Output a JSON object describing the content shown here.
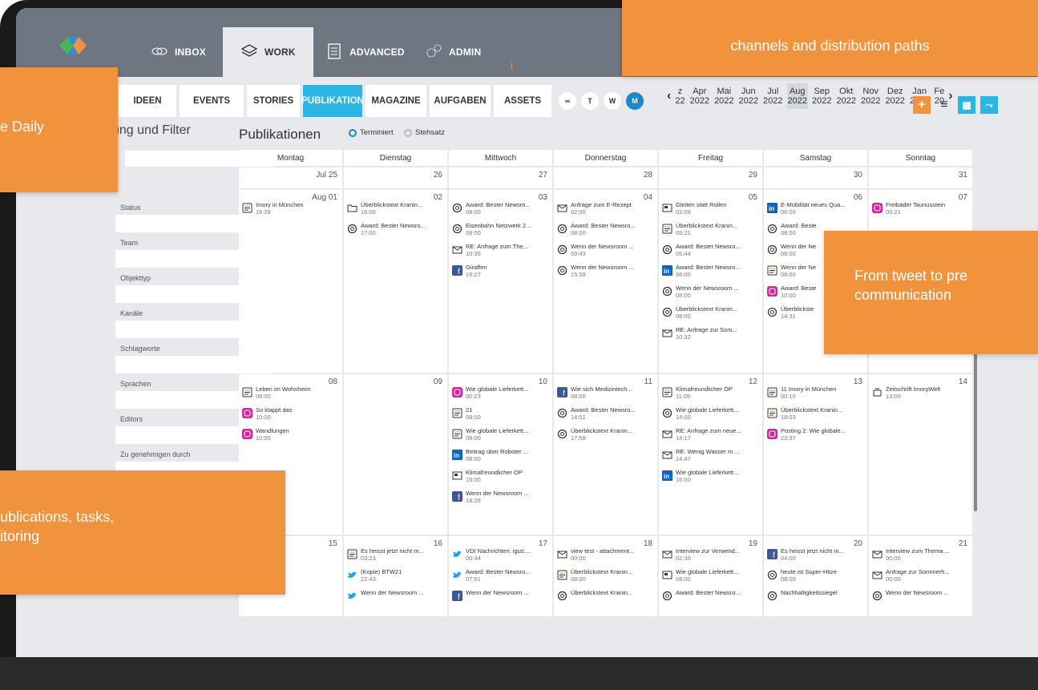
{
  "nav": {
    "tabs": [
      {
        "label": "INBOX",
        "icon": "inbox-icon"
      },
      {
        "label": "WORK",
        "icon": "layers-icon",
        "active": true
      },
      {
        "label": "ADVANCED",
        "icon": "document-icon"
      },
      {
        "label": "ADMIN",
        "icon": "gears-icon"
      }
    ],
    "marker": "i"
  },
  "subtabs": [
    "IDEEN",
    "EVENTS",
    "STORIES",
    "PUBLIKATION",
    "MAGAZINE",
    "AUFGABEN",
    "ASSETS"
  ],
  "view_buttons": [
    "∞",
    "T",
    "W",
    "M"
  ],
  "months": [
    {
      "m": "z",
      "y": "22"
    },
    {
      "m": "Apr",
      "y": "2022"
    },
    {
      "m": "Mai",
      "y": "2022"
    },
    {
      "m": "Jun",
      "y": "2022"
    },
    {
      "m": "Jul",
      "y": "2022"
    },
    {
      "m": "Aug",
      "y": "2022"
    },
    {
      "m": "Sep",
      "y": "2022"
    },
    {
      "m": "Okt",
      "y": "2022"
    },
    {
      "m": "Nov",
      "y": "2022"
    },
    {
      "m": "Dez",
      "y": "2022"
    },
    {
      "m": "Jan",
      "y": "2023"
    },
    {
      "m": "Fe",
      "y": "20"
    }
  ],
  "filter": {
    "title": "ung und Filter",
    "fields": [
      "Status",
      "Team",
      "Objekttyp",
      "Kanäle",
      "Schlagworte",
      "Sprachen",
      "Editors",
      "Zu genehmigen durch"
    ]
  },
  "calendar": {
    "title": "Publikationen",
    "radio_on": "Terminiert",
    "radio_off": "Stehsatz",
    "days": [
      "Montag",
      "Dienstag",
      "Mittwoch",
      "Donnerstag",
      "Freitag",
      "Samstag",
      "Sonntag"
    ],
    "week0": [
      "Jul 25",
      "26",
      "27",
      "28",
      "29",
      "30",
      "31"
    ],
    "week1": [
      {
        "n": "Aug 01",
        "ev": [
          [
            "doc",
            "Imory in München",
            "16:28"
          ]
        ]
      },
      {
        "n": "02",
        "ev": [
          [
            "folder",
            "Überblickstext Kranin...",
            "16:06"
          ],
          [
            "at",
            "Award: Bester Newsro...",
            "17:00"
          ]
        ]
      },
      {
        "n": "03",
        "ev": [
          [
            "at",
            "Award: Bester Newsro...",
            "08:00"
          ],
          [
            "at",
            "Eisenbahn Netzwerk 2...",
            "08:00"
          ],
          [
            "mail",
            "RE: Anfrage zum The...",
            "10:35"
          ],
          [
            "fb",
            "Giraffen",
            "19:27"
          ]
        ]
      },
      {
        "n": "04",
        "ev": [
          [
            "mail",
            "Anfrage zum E-Rezept",
            "02:00"
          ],
          [
            "at",
            "Award: Bester Newsro...",
            "08:00"
          ],
          [
            "at",
            "Wenn der Newsroom ...",
            "09:43"
          ],
          [
            "at",
            "Wenn der Newsroom ...",
            "15:58"
          ]
        ]
      },
      {
        "n": "05",
        "ev": [
          [
            "news",
            "Gleiten statt Rollen",
            "02:09"
          ],
          [
            "doc",
            "Überblickstext Kranin...",
            "05:21"
          ],
          [
            "at",
            "Award: Bester Newsro...",
            "05:44"
          ],
          [
            "in",
            "Award: Bester Newsro...",
            "08:00"
          ],
          [
            "at",
            "Wenn der Newsroom ...",
            "08:00"
          ],
          [
            "at",
            "Überblickstext Kranin...",
            "08:00"
          ],
          [
            "mail",
            "RE: Anfrage zur Som...",
            "10:32"
          ]
        ]
      },
      {
        "n": "06",
        "ev": [
          [
            "in",
            "E-Mobilität neues Qua...",
            "06:00"
          ],
          [
            "at",
            "Award: Beste",
            "08:00"
          ],
          [
            "at",
            "Wenn der Ne",
            "08:00"
          ],
          [
            "doc",
            "Wenn der Ne",
            "08:00"
          ],
          [
            "ig",
            "Award: Beste",
            "10:00"
          ],
          [
            "at",
            "Überblickste",
            "14:31"
          ]
        ]
      },
      {
        "n": "07",
        "ev": [
          [
            "ig",
            "Freibäder Taunusstein",
            "05:21"
          ]
        ]
      }
    ],
    "week2": [
      {
        "n": "08",
        "ev": [
          [
            "doc",
            "Leben im Wohnheim",
            "08:00"
          ],
          [
            "ig",
            "So klappt das",
            "10:00"
          ],
          [
            "ig",
            "Wandlungen",
            "10:00"
          ]
        ]
      },
      {
        "n": "09",
        "ev": []
      },
      {
        "n": "10",
        "ev": [
          [
            "ig",
            "Wie globale Lieferkett...",
            "00:23"
          ],
          [
            "doc",
            "21",
            "08:00"
          ],
          [
            "doc",
            "Wie globale Lieferkett...",
            "08:00"
          ],
          [
            "in",
            "Beitrag über Roboter ...",
            "08:00"
          ],
          [
            "news",
            "Klimafreundlicher OP",
            "15:00"
          ],
          [
            "fb",
            "Wenn der Newsroom ...",
            "18:28"
          ]
        ]
      },
      {
        "n": "11",
        "ev": [
          [
            "fb",
            "Wie sich Medizintech...",
            "08:00"
          ],
          [
            "at",
            "Award: Bester Newsro...",
            "14:51"
          ],
          [
            "at",
            "Überblickstext Kranin...",
            "17:58"
          ]
        ]
      },
      {
        "n": "12",
        "ev": [
          [
            "doc",
            "Klimafreundlicher OP",
            "11:05"
          ],
          [
            "at",
            "Wie globale Lieferkett...",
            "14:00"
          ],
          [
            "mail",
            "RE: Anfrage zum neue...",
            "14:17"
          ],
          [
            "mail",
            "RE: Wenig Wasser m ...",
            "14:47"
          ],
          [
            "in",
            "Wie globale Lieferkett...",
            "16:00"
          ]
        ]
      },
      {
        "n": "13",
        "ev": [
          [
            "doc",
            "11 Imory in München",
            "00:10"
          ],
          [
            "doc",
            "Überblickstext Kranin...",
            "18:03"
          ],
          [
            "ig",
            "Posting 2: Wie globale...",
            "23:37"
          ]
        ]
      },
      {
        "n": "14",
        "ev": [
          [
            "mag",
            "Zeitschrift ImoryWelt",
            "13:00"
          ]
        ]
      }
    ],
    "week3": [
      {
        "n": "15",
        "ev": []
      },
      {
        "n": "16",
        "ev": [
          [
            "doc",
            "Es heisst jetzt nicht m...",
            "03:23"
          ],
          [
            "tw",
            "(Kopie) BTW21",
            "22:43"
          ],
          [
            "tw",
            "Wenn der Newsroom ...",
            ""
          ]
        ]
      },
      {
        "n": "17",
        "ev": [
          [
            "tw",
            "VDI Nachrichten: igus:...",
            "00:44"
          ],
          [
            "tw",
            "Award: Bester Newsro...",
            "07:51"
          ],
          [
            "fb",
            "Wenn der Newsroom ...",
            ""
          ]
        ]
      },
      {
        "n": "18",
        "ev": [
          [
            "mail",
            "view test - attachment...",
            "00:00"
          ],
          [
            "doc",
            "Überblickstext Kranin...",
            "08:00"
          ],
          [
            "at",
            "Überblickstext Kranin...",
            ""
          ]
        ]
      },
      {
        "n": "19",
        "ev": [
          [
            "mail",
            "Interview zur Verwend...",
            "02:30"
          ],
          [
            "news",
            "Wie globale Lieferkett...",
            "08:00"
          ],
          [
            "at",
            "Award: Bester Newsro...",
            ""
          ]
        ]
      },
      {
        "n": "20",
        "ev": [
          [
            "fb",
            "Es heisst jetzt nicht m...",
            "04:00"
          ],
          [
            "at",
            "heute ist Super-Hitze",
            "08:00"
          ],
          [
            "at",
            "Nachhaltigkeitssiegel",
            ""
          ]
        ]
      },
      {
        "n": "21",
        "ev": [
          [
            "mail",
            "Interview zum Thema ...",
            "00:00"
          ],
          [
            "mail",
            "Anfrage zur Sommerh...",
            "00:00"
          ],
          [
            "at",
            "Wenn der Newsroom ...",
            ""
          ]
        ]
      }
    ]
  },
  "overlays": [
    {
      "text": "channels and distribution paths"
    },
    {
      "text": "e Daily"
    },
    {
      "text": "From tweet to pre\ncommunication"
    },
    {
      "text": "ublications, tasks,\nitoring"
    }
  ],
  "colors": {
    "nav": "#6e7682",
    "accent": "#29b6e5",
    "orange": "#f1933d"
  }
}
